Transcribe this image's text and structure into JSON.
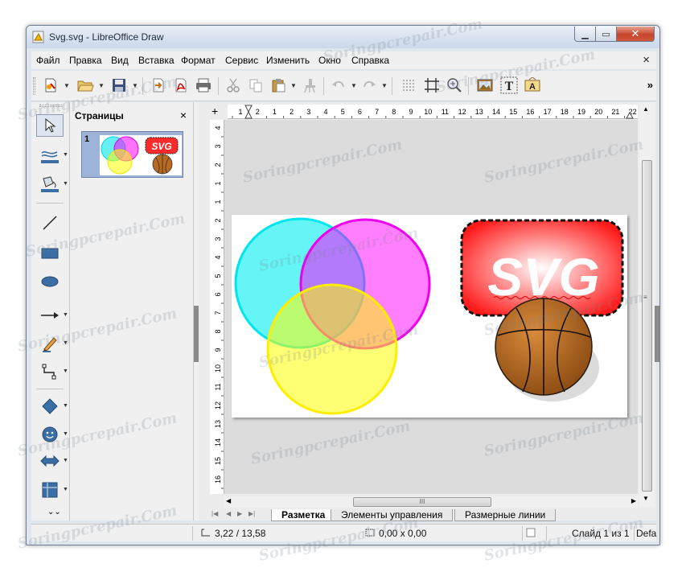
{
  "window": {
    "title": "Svg.svg - LibreOffice Draw"
  },
  "menu": {
    "items": [
      "Файл",
      "Правка",
      "Вид",
      "Вставка",
      "Формат",
      "Сервис",
      "Изменить",
      "Окно",
      "Справка"
    ],
    "close_glyph": "×"
  },
  "toolbar": {
    "icons": [
      "new-document-icon",
      "open-folder-icon",
      "save-icon",
      "export-icon",
      "export-pdf-icon",
      "print-icon",
      "cut-icon",
      "copy-icon",
      "paste-icon",
      "clone-formatting-icon",
      "undo-icon",
      "redo-icon",
      "grid-icon",
      "helplines-icon",
      "zoom-pan-icon",
      "image-icon",
      "text-icon",
      "fontwork-icon"
    ],
    "overflow_glyph": "»"
  },
  "pages_panel": {
    "title": "Страницы",
    "close_glyph": "×",
    "thumb_number": "1",
    "thumb_badge": "SVG"
  },
  "ruler": {
    "h_ticks": [
      "1",
      "2",
      "1",
      "2",
      "3",
      "4",
      "5",
      "6",
      "7",
      "8",
      "9",
      "10",
      "11",
      "12",
      "13",
      "14",
      "15",
      "16",
      "17",
      "18",
      "19",
      "20",
      "21",
      "22"
    ],
    "v_ticks": [
      "4",
      "3",
      "2",
      "1",
      "1",
      "2",
      "3",
      "4",
      "5",
      "6",
      "7",
      "8",
      "9",
      "10",
      "11",
      "12",
      "13",
      "14",
      "15",
      "16"
    ]
  },
  "canvas": {
    "svg_label": "SVG"
  },
  "tabs": [
    "Разметка",
    "Элементы управления",
    "Размерные линии"
  ],
  "hscroll_grip": "III",
  "status": {
    "position": "3,22 / 13,58",
    "size": "0,00 x 0,00",
    "slide": "Слайд 1 из 1",
    "layout": "Defa"
  },
  "watermark": "Soringpcrepair.Com",
  "colors": {
    "accent": "#3a6ea5",
    "cyan": "#00e5ee",
    "magenta": "#ff00ff",
    "yellow": "#ffff00",
    "ball": "#b86a1e",
    "svg_red": "#ff2020"
  }
}
